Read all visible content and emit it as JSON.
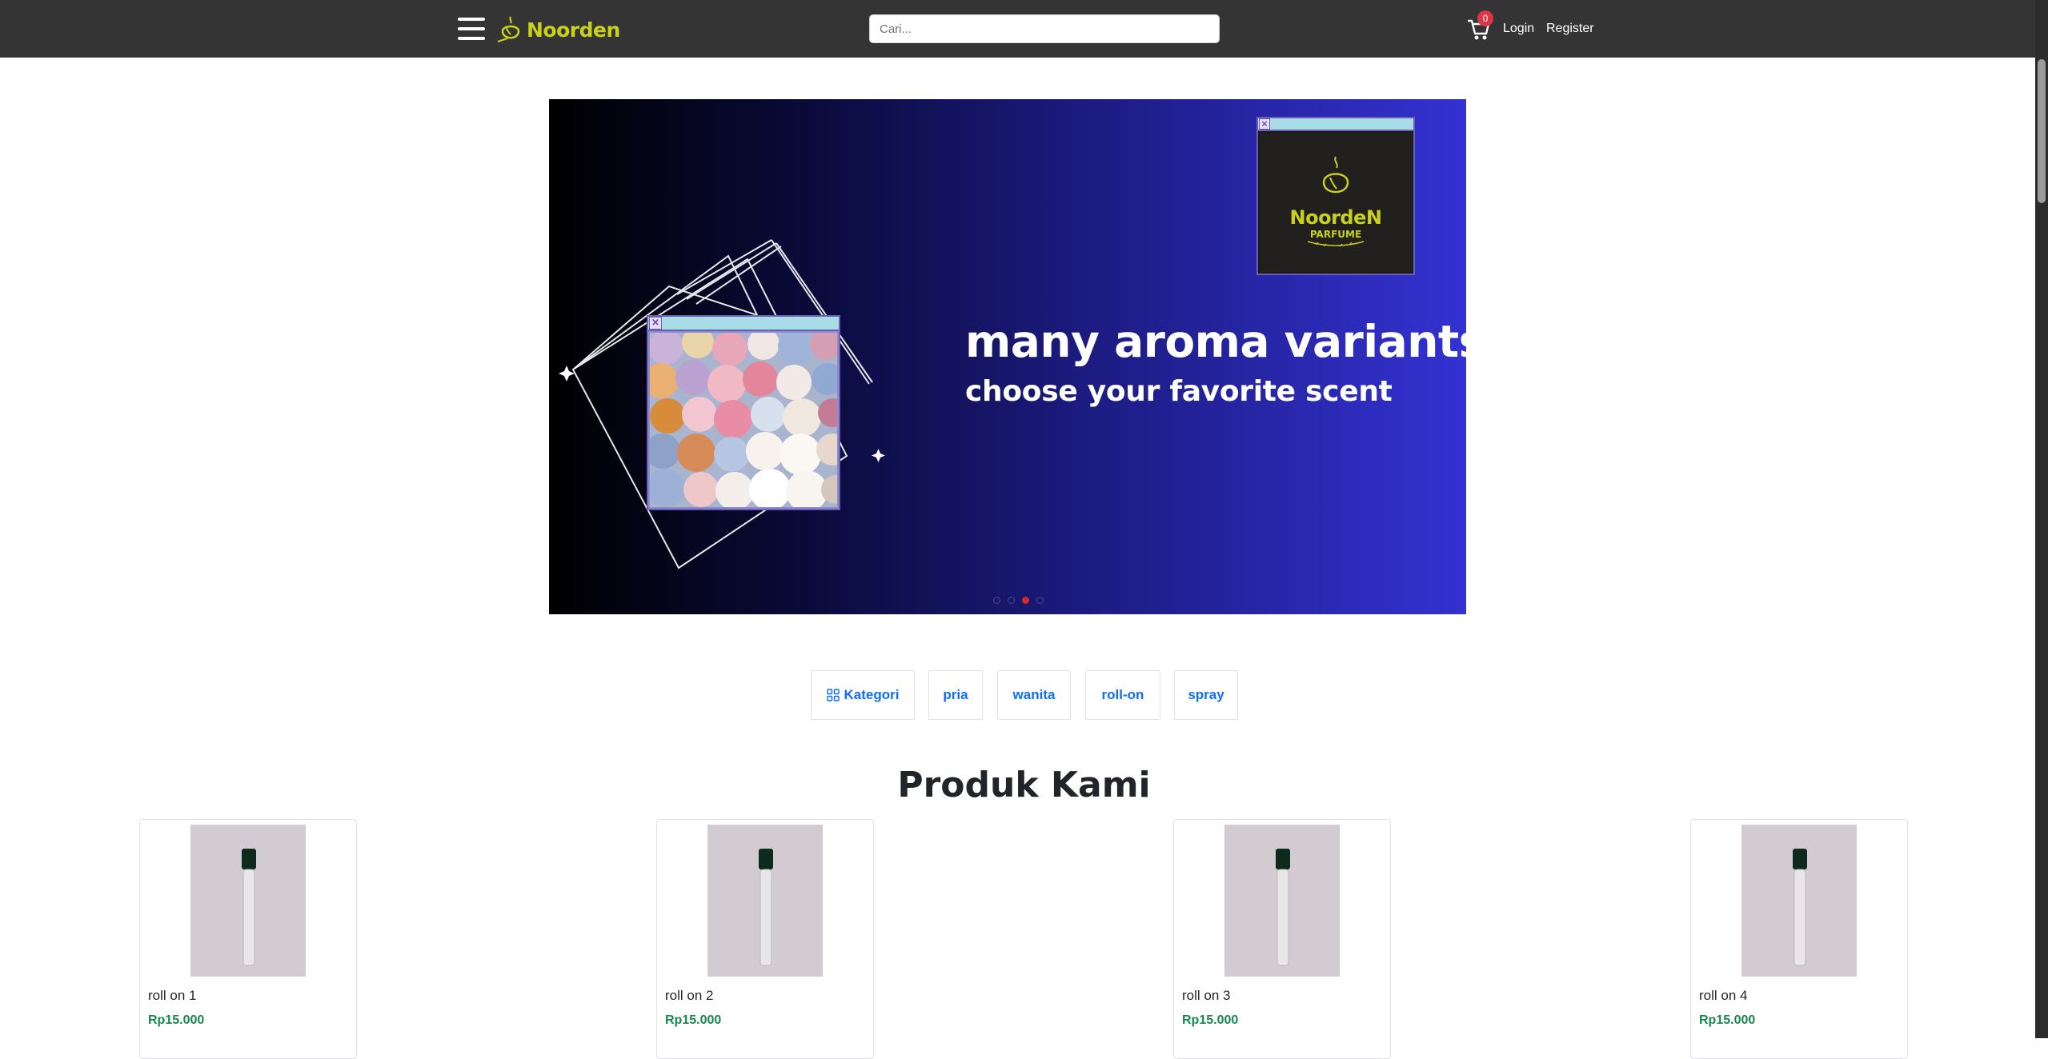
{
  "navbar": {
    "brand_name": "Noorden",
    "search_placeholder": "Cari...",
    "cart_count": "0",
    "login_label": "Login",
    "register_label": "Register"
  },
  "carousel": {
    "heading": "many aroma variants",
    "subheading": "choose your favorite scent",
    "popup_logo": {
      "brand": "NoordeN",
      "tagline": "PARFUME"
    },
    "slide_count": 4,
    "active_slide": 3
  },
  "categories": {
    "menu_label": "Kategori",
    "items": [
      "pria",
      "wanita",
      "roll-on",
      "spray"
    ]
  },
  "products": {
    "title": "Produk Kami",
    "items": [
      {
        "name": "roll on 1",
        "price": "Rp15.000"
      },
      {
        "name": "roll on 2",
        "price": "Rp15.000"
      },
      {
        "name": "roll on 3",
        "price": "Rp15.000"
      },
      {
        "name": "roll on 4",
        "price": "Rp15.000"
      }
    ]
  },
  "colors": {
    "navbar_bg": "#343434",
    "brand_yellow": "#c9d11a",
    "link_blue": "#0d6efd",
    "price_green": "#198754",
    "badge_red": "#dc3545",
    "active_indicator": "#d7262c"
  },
  "icons": [
    "hamburger-icon",
    "perfume-bottle-icon",
    "cart-icon",
    "grid-icon",
    "close-icon"
  ]
}
